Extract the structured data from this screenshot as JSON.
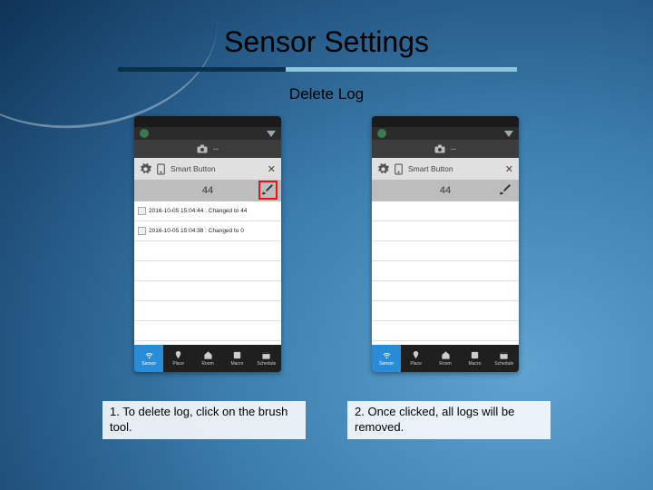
{
  "header": {
    "title": "Sensor Settings",
    "subtitle": "Delete Log"
  },
  "phone_common": {
    "camera_label": "--",
    "device_label": "Smart Button",
    "count": "44",
    "nav": [
      {
        "label": "Sensor",
        "active": true
      },
      {
        "label": "Place",
        "active": false
      },
      {
        "label": "Room",
        "active": false
      },
      {
        "label": "Macro",
        "active": false
      },
      {
        "label": "Schedule",
        "active": false
      }
    ]
  },
  "phone1": {
    "highlight_brush": true,
    "logs": [
      "2016-10-05 15:04:44 : Changed to 44",
      "2016-10-05 15:04:38 : Changed to 0"
    ]
  },
  "phone2": {
    "highlight_brush": false,
    "logs": []
  },
  "captions": {
    "left": "1. To delete log, click on the brush tool.",
    "right": "2. Once clicked, all logs will be removed."
  }
}
